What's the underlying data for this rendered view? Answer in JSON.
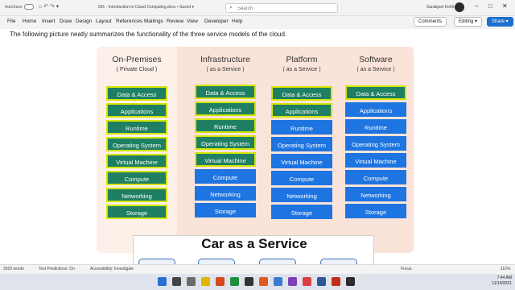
{
  "titlebar": {
    "autosave": "AutoSave",
    "doc_title": "001 - Introduction to Cloud Computing.docx • Saved ▾",
    "search_placeholder": "Search",
    "user": "Sarabjeet Kohli"
  },
  "menu": {
    "tabs": [
      "File",
      "Home",
      "Insert",
      "Draw",
      "Design",
      "Layout",
      "References",
      "Mailings",
      "Review",
      "View",
      "Developer",
      "Help"
    ],
    "comments": "Comments",
    "editing": "Editing ▾",
    "share": "Share ▾"
  },
  "document": {
    "intro": "The following picture neatly summarizes the functionality of the three service models of the cloud."
  },
  "diagram": {
    "colors": {
      "green": "#1e7f63",
      "blue": "#1e74e0",
      "border": "#d4e400"
    },
    "columns": [
      {
        "title": "On-Premises",
        "subtitle": "( Private Cloud )",
        "tiles": [
          {
            "label": "Data & Access",
            "kind": "green"
          },
          {
            "label": "Applications",
            "kind": "green"
          },
          {
            "label": "Runtime",
            "kind": "green"
          },
          {
            "label": "Operating System",
            "kind": "green"
          },
          {
            "label": "Virtual Machine",
            "kind": "green"
          },
          {
            "label": "Compute",
            "kind": "green"
          },
          {
            "label": "Networking",
            "kind": "green"
          },
          {
            "label": "Storage",
            "kind": "green"
          }
        ]
      },
      {
        "title": "Infrastructure",
        "subtitle": "( as a Service )",
        "tiles": [
          {
            "label": "Data & Access",
            "kind": "green"
          },
          {
            "label": "Applications",
            "kind": "green"
          },
          {
            "label": "Runtime",
            "kind": "green"
          },
          {
            "label": "Operating System",
            "kind": "green"
          },
          {
            "label": "Virtual Machine",
            "kind": "green"
          },
          {
            "label": "Compute",
            "kind": "blue"
          },
          {
            "label": "Networking",
            "kind": "blue"
          },
          {
            "label": "Storage",
            "kind": "blue"
          }
        ]
      },
      {
        "title": "Platform",
        "subtitle": "( as a Service )",
        "tiles": [
          {
            "label": "Data & Access",
            "kind": "green"
          },
          {
            "label": "Applications",
            "kind": "green"
          },
          {
            "label": "Runtime",
            "kind": "blue"
          },
          {
            "label": "Operating System",
            "kind": "blue"
          },
          {
            "label": "Virtual Machine",
            "kind": "blue"
          },
          {
            "label": "Compute",
            "kind": "blue"
          },
          {
            "label": "Networking",
            "kind": "blue"
          },
          {
            "label": "Storage",
            "kind": "blue"
          }
        ]
      },
      {
        "title": "Software",
        "subtitle": "( as a Service )",
        "tiles": [
          {
            "label": "Data & Access",
            "kind": "green"
          },
          {
            "label": "Applications",
            "kind": "blue"
          },
          {
            "label": "Runtime",
            "kind": "blue"
          },
          {
            "label": "Operating System",
            "kind": "blue"
          },
          {
            "label": "Virtual Machine",
            "kind": "blue"
          },
          {
            "label": "Compute",
            "kind": "blue"
          },
          {
            "label": "Networking",
            "kind": "blue"
          },
          {
            "label": "Storage",
            "kind": "blue"
          }
        ]
      }
    ]
  },
  "car": {
    "title": "Car as a Service"
  },
  "statusbar": {
    "words": "2925 words",
    "predictions": "Text Predictions: On",
    "accessibility": "Accessibility: Investigate",
    "focus": "Focus",
    "zoom": "110%"
  },
  "taskbar": {
    "time": "7:44 AM",
    "date": "11/19/2021"
  }
}
